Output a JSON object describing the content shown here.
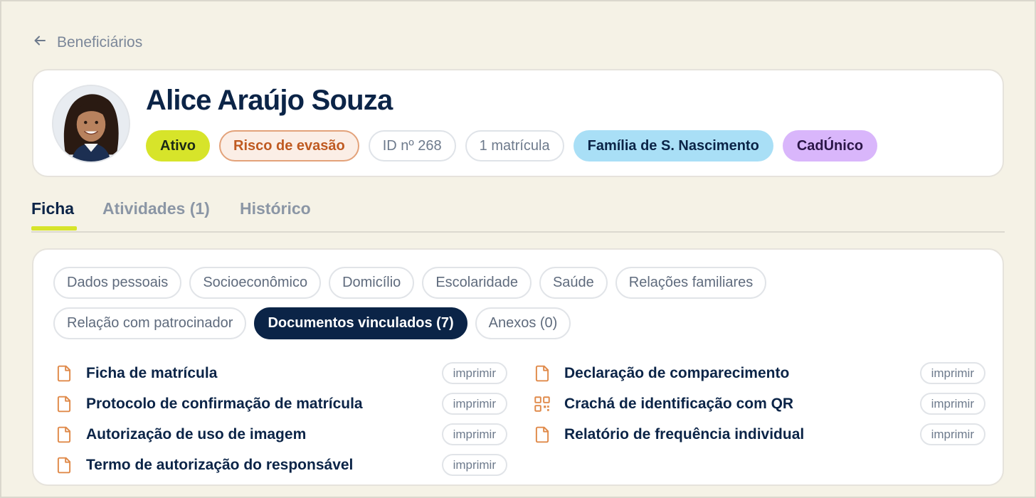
{
  "back": {
    "label": "Beneficiários"
  },
  "profile": {
    "name": "Alice Araújo Souza",
    "chips": {
      "status": "Ativo",
      "risk": "Risco de evasão",
      "id": "ID nº 268",
      "enrollments": "1 matrícula",
      "family": "Família de S. Nascimento",
      "program": "CadÚnico"
    }
  },
  "tabs": [
    {
      "label": "Ficha",
      "active": true
    },
    {
      "label": "Atividades (1)",
      "active": false
    },
    {
      "label": "Histórico",
      "active": false
    }
  ],
  "subtabs": [
    "Dados pessoais",
    "Socioeconômico",
    "Domicílio",
    "Escolaridade",
    "Saúde",
    "Relações familiares",
    "Relação com patrocinador",
    "Documentos vinculados (7)",
    "Anexos (0)"
  ],
  "active_subtab": "Documentos vinculados (7)",
  "print_label": "imprimir",
  "documents_left": [
    {
      "title": "Ficha de matrícula",
      "icon": "document-icon"
    },
    {
      "title": "Protocolo de confirmação de matrícula",
      "icon": "document-icon"
    },
    {
      "title": "Autorização de uso de imagem",
      "icon": "document-icon"
    },
    {
      "title": "Termo de autorização do responsável",
      "icon": "document-icon"
    }
  ],
  "documents_right": [
    {
      "title": "Declaração de comparecimento",
      "icon": "document-icon"
    },
    {
      "title": "Crachá de identificação com QR",
      "icon": "qr-code-icon"
    },
    {
      "title": "Relatório de frequência individual",
      "icon": "document-icon"
    }
  ],
  "colors": {
    "background": "#f5f2e6",
    "navy": "#0b2447",
    "accent_lime": "#d7e42a",
    "risk_orange": "#bf5a21",
    "family_blue": "#a9dff6",
    "program_purple": "#d9b6fb",
    "doc_icon_orange": "#e08a4a"
  }
}
